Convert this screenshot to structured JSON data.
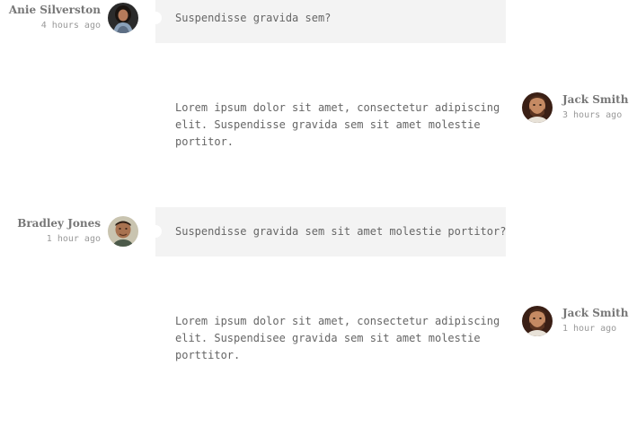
{
  "messages": [
    {
      "author": "Anie Silverston",
      "time": "4 hours ago",
      "text": "Suspendisse gravida sem?",
      "avatar_icon": "woman-portrait-avatar"
    },
    {
      "author": "Jack Smith",
      "time": "3 hours ago",
      "text_lines": [
        "Lorem ipsum dolor sit amet, consectetur adipiscing",
        "elit. Suspendisse gravida sem sit amet molestie",
        "portitor."
      ],
      "avatar_icon": "bearded-man-avatar"
    },
    {
      "author": "Bradley Jones",
      "time": "1 hour ago",
      "text": "Suspendisse gravida sem sit amet molestie portitor?",
      "avatar_icon": "man-portrait-avatar"
    },
    {
      "author": "Jack Smith",
      "time": "1 hour ago",
      "text_lines": [
        "Lorem ipsum dolor sit amet, consectetur adipiscing",
        "elit. Suspendisee gravida sem sit amet molestie",
        "porttitor."
      ],
      "avatar_icon": "bearded-man-avatar"
    }
  ],
  "colors": {
    "bubble_bg": "#f3f3f3",
    "text": "#666666",
    "author": "#777777",
    "time": "#999999"
  }
}
